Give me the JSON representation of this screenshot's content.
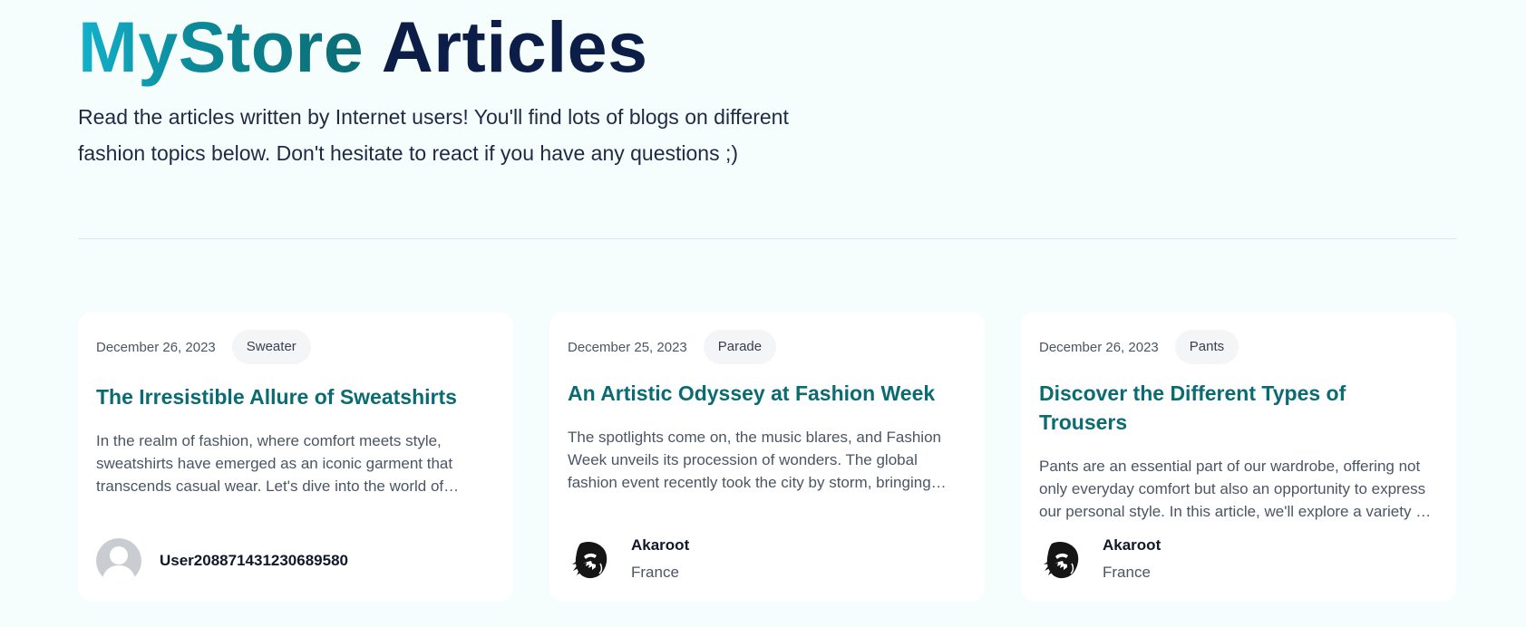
{
  "header": {
    "title_brand": "MyStore",
    "title_rest": "Articles",
    "intro": "Read the articles written by Internet users! You'll find lots of blogs on different fashion topics below. Don't hesitate to react if you have any questions ;)"
  },
  "articles": [
    {
      "date": "December 26, 2023",
      "tag": "Sweater",
      "title": "The Irresistible Allure of Sweatshirts",
      "excerpt": "In the realm of fashion, where comfort meets style, sweatshirts have emerged as an iconic garment that transcends casual wear. Let's dive into the world of sweatshirts.",
      "author": {
        "name": "User208871431230689580",
        "country": "",
        "avatar_icon": "default-user-icon"
      }
    },
    {
      "date": "December 25, 2023",
      "tag": "Parade",
      "title": "An Artistic Odyssey at Fashion Week",
      "excerpt": "The spotlights come on, the music blares, and Fashion Week unveils its procession of wonders. The global fashion event recently took the city by storm, bringing together designers.",
      "author": {
        "name": "Akaroot",
        "country": "France",
        "avatar_icon": "black-creature-avatar"
      }
    },
    {
      "date": "December 26, 2023",
      "tag": "Pants",
      "title": "Discover the Different Types of Trousers",
      "excerpt": "Pants are an essential part of our wardrobe, offering not only everyday comfort but also an opportunity to express our personal style. In this article, we'll explore a variety of trousers.",
      "author": {
        "name": "Akaroot",
        "country": "France",
        "avatar_icon": "black-creature-avatar"
      }
    }
  ],
  "colors": {
    "background": "#f5fdfd",
    "brand_gradient_start": "#12b2cc",
    "brand_gradient_end": "#0b6b72",
    "title_dark": "#0c1e47",
    "card_title": "#0b6b72"
  }
}
